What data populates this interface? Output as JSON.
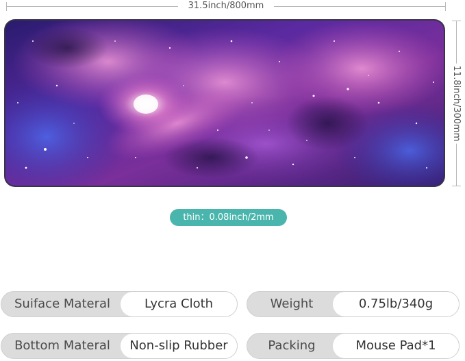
{
  "dimensions": {
    "width_label": "31.5inch/800mm",
    "height_label": "11.8inch/300mm"
  },
  "thickness_label": "thin：0.08inch/2mm",
  "specs": [
    {
      "key": "Suiface Materal",
      "value": "Lycra Cloth"
    },
    {
      "key": "Weight",
      "value": "0.75lb/340g"
    },
    {
      "key": "Bottom Materal",
      "value": "Non-slip Rubber"
    },
    {
      "key": "Packing",
      "value": "Mouse Pad*1"
    }
  ],
  "colors": {
    "pill": "#4ab5ad",
    "spec_bg": "#dcdcdc",
    "nebula_pink": "#e070c8",
    "nebula_purple": "#6a2fb5",
    "nebula_blue": "#2a3aa8"
  }
}
